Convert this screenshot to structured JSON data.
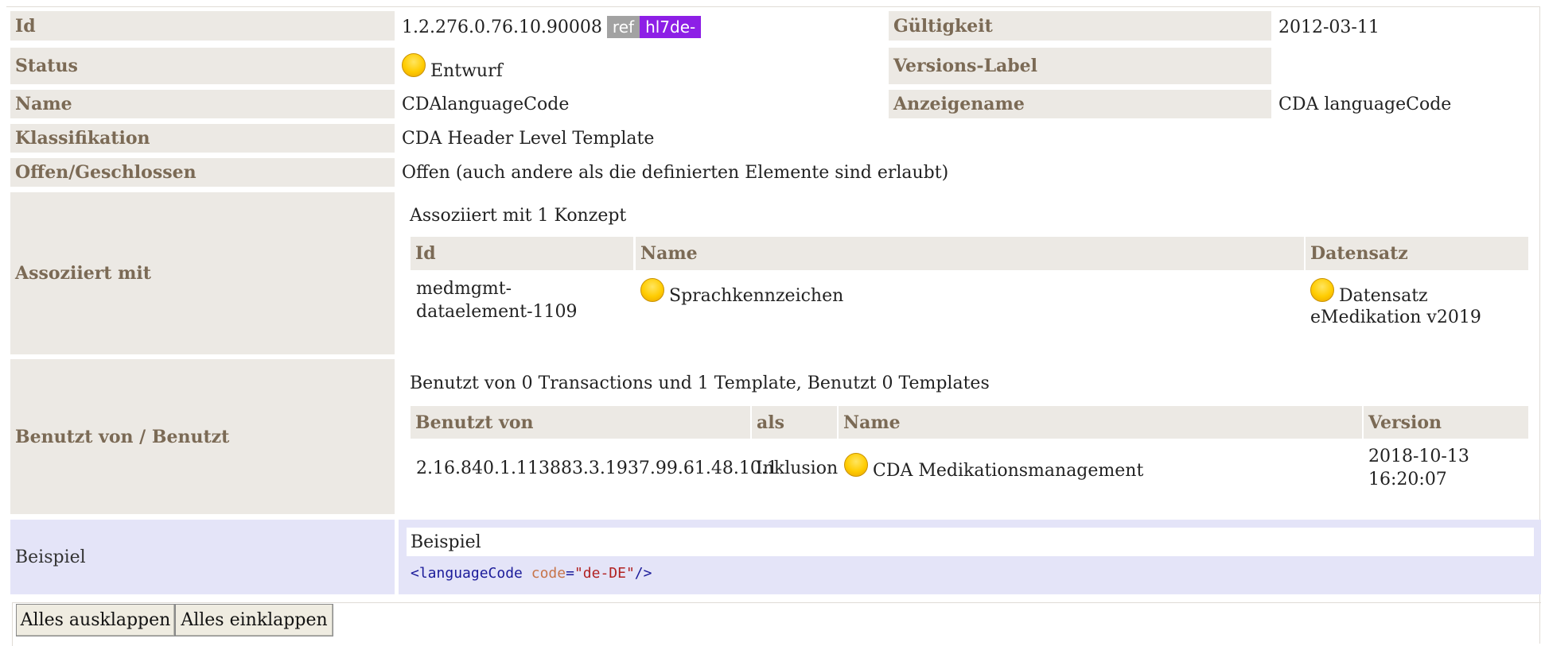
{
  "rows": {
    "id": {
      "label": "Id",
      "value": "1.2.276.0.76.10.90008",
      "badge_ref": "ref",
      "badge_hl7": "hl7de-"
    },
    "validity": {
      "label": "Gültigkeit",
      "value": "2012-03-11"
    },
    "status": {
      "label": "Status",
      "value": "Entwurf",
      "icon": "status-draft-dot"
    },
    "version_label": {
      "label": "Versions-Label",
      "value": ""
    },
    "name": {
      "label": "Name",
      "value": "CDAlanguageCode"
    },
    "display_name": {
      "label": "Anzeigename",
      "value": "CDA languageCode"
    },
    "classification": {
      "label": "Klassifikation",
      "value": "CDA Header Level Template"
    },
    "open_closed": {
      "label": "Offen/Geschlossen",
      "value": "Offen (auch andere als die definierten Elemente sind erlaubt)"
    }
  },
  "associated": {
    "label": "Assoziiert mit",
    "summary": "Assoziiert mit 1 Konzept",
    "headers": {
      "id": "Id",
      "name": "Name",
      "dataset": "Datensatz"
    },
    "items": [
      {
        "id_line1": "medmgmt-",
        "id_line2": "dataelement-1109",
        "name": "Sprachkennzeichen",
        "dataset_line1": "Datensatz",
        "dataset_line2": "eMedikation v2019"
      }
    ]
  },
  "used_by": {
    "label": "Benutzt von / Benutzt",
    "summary": "Benutzt von 0 Transactions und 1 Template, Benutzt 0 Templates",
    "headers": {
      "used_by": "Benutzt von",
      "as": "als",
      "name": "Name",
      "version": "Version"
    },
    "items": [
      {
        "used_by": "2.16.840.1.113883.3.1937.99.61.48.10.1",
        "as": "Inklusion",
        "name": "CDA Medikationsmanagement",
        "version_line1": "2018-10-13",
        "version_line2": "16:20:07"
      }
    ]
  },
  "example": {
    "label": "Beispiel",
    "title": "Beispiel",
    "code_open": "<",
    "code_tag": "languageCode",
    "code_attr": "code",
    "code_eq": "=",
    "code_val": "\"de-DE\"",
    "code_close": "/>"
  },
  "buttons": {
    "expand_all": "Alles ausklappen",
    "collapse_all": "Alles einklappen"
  },
  "colors": {
    "label_bg": "#ece9e4",
    "label_text": "#7b6a55",
    "example_bg": "#e4e4f8",
    "ref_badge": "#a2a2a2",
    "hl7_badge": "#8d1fe6",
    "status_dot": "#ffcc00"
  }
}
